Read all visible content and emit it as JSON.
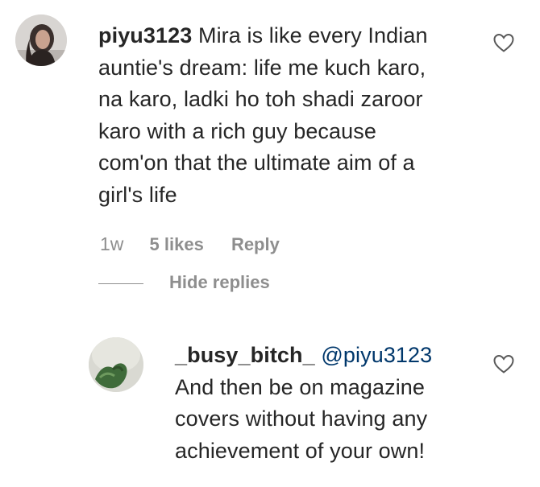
{
  "comment": {
    "username": "piyu3123",
    "lines": [
      "Mira is like every Indian",
      "auntie's dream: life me kuch karo,",
      "na karo, ladki ho toh shadi zaroor",
      "karo with a rich guy because",
      "com'on that the ultimate aim of a",
      "girl's life"
    ],
    "time": "1w",
    "likes": "5 likes",
    "reply_label": "Reply",
    "like_icon": "heart-outline-icon"
  },
  "replies_toggle": "Hide replies",
  "reply": {
    "username": "_busy_bitch_",
    "mention": "@piyu3123",
    "lines": [
      "And then be on magazine",
      "covers without having any",
      "achievement of your own!"
    ],
    "like_icon": "heart-outline-icon"
  },
  "colors": {
    "text": "#262626",
    "muted": "#8e8e8e",
    "mention": "#00376b"
  }
}
